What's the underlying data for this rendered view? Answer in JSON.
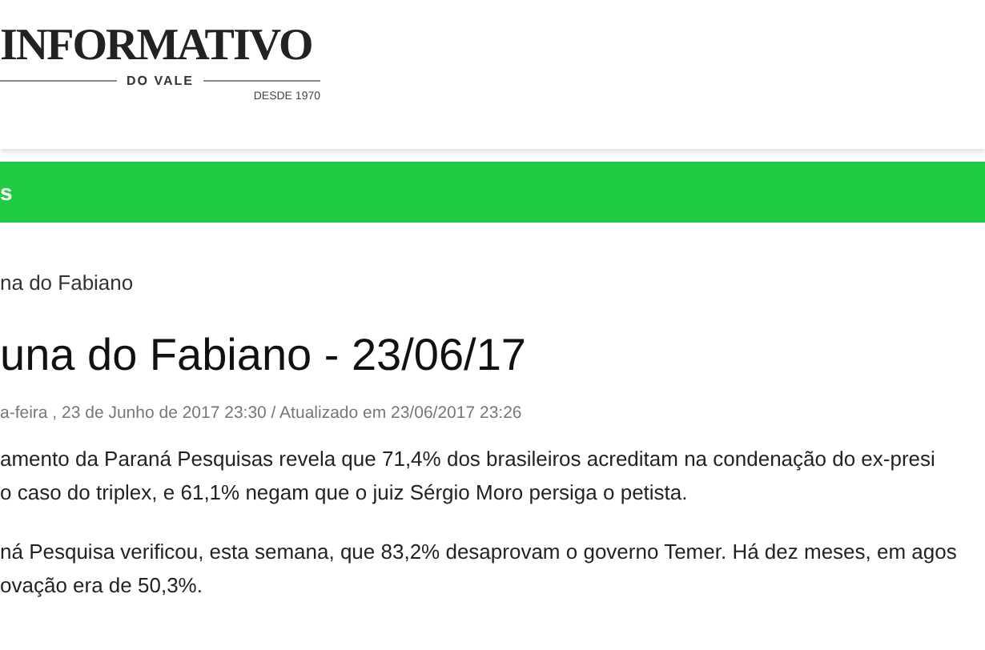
{
  "logo": {
    "name": "INFORMATIVO",
    "subtitle": "DO VALE",
    "since": "DESDE 1970"
  },
  "nav_bar": {
    "label": "s"
  },
  "breadcrumb": "na do Fabiano",
  "article": {
    "title": "una do Fabiano - 23/06/17",
    "meta": "a-feira , 23 de Junho de 2017 23:30 / Atualizado em 23/06/2017 23:26",
    "paragraphs": [
      [
        "amento da Paraná Pesquisas revela que 71,4% dos brasileiros acreditam na condenação do ex-presi",
        "o caso do triplex, e 61,1% negam que o juiz Sérgio Moro persiga o petista."
      ],
      [
        "ná Pesquisa verificou, esta semana, que 83,2% desaprovam o governo Temer. Há dez meses, em agos",
        "ovação era de 50,3%."
      ]
    ]
  }
}
